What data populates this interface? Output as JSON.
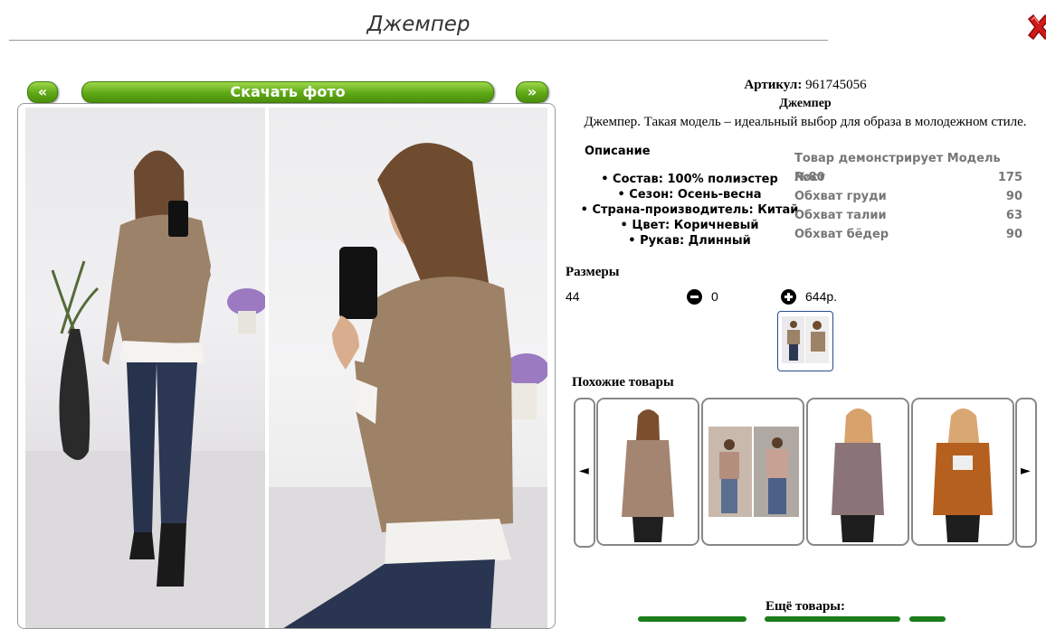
{
  "page": {
    "title": "Джемпер"
  },
  "gallery": {
    "prev_label": "«",
    "next_label": "»",
    "download_label": "Скачать фото"
  },
  "product": {
    "article_label": "Артикул:",
    "article_value": "961745056",
    "name": "Джемпер",
    "description": "Джемпер. Такая модель – идеальный выбор для образа в молодежном стиле."
  },
  "details": {
    "heading": "Описание",
    "items": [
      "Состав: 100% полиэстер",
      "Сезон: Осень-весна",
      "Страна-производитель: Китай",
      "Цвет: Коричневый",
      "Рукав: Длинный"
    ]
  },
  "model": {
    "heading": "Товар демонстрирует Модель №80",
    "rows": [
      {
        "label": "Рост",
        "value": "175"
      },
      {
        "label": "Обхват груди",
        "value": "90"
      },
      {
        "label": "Обхват талии",
        "value": "63"
      },
      {
        "label": "Обхват бёдер",
        "value": "90"
      }
    ]
  },
  "sizes": {
    "heading": "Размеры",
    "size": "44",
    "quantity": "0",
    "price": "644р."
  },
  "similar": {
    "heading": "Похожие товары",
    "prev_icon": "◄",
    "next_icon": "►"
  },
  "more": {
    "heading": "Ещё товары:"
  },
  "colors": {
    "accent_green": "#5ea815",
    "close_red": "#d11a1a",
    "thumb_border": "#2a4c8c"
  }
}
